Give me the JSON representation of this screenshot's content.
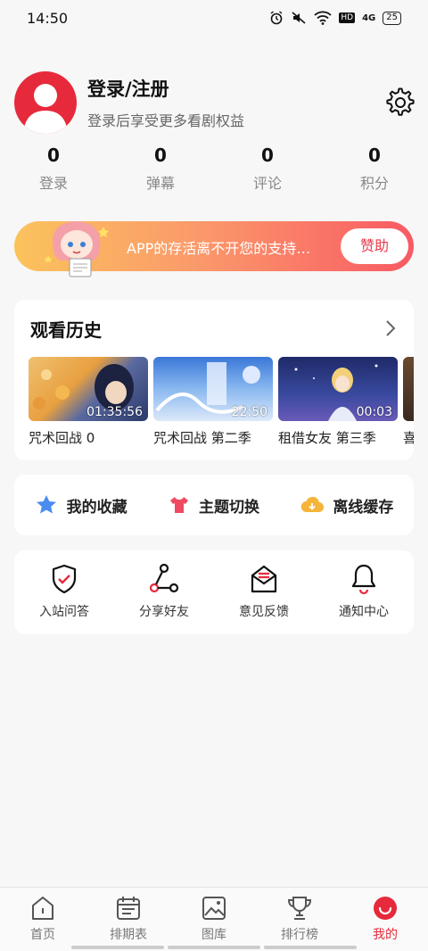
{
  "status_bar": {
    "time": "14:50",
    "battery": "25",
    "network": "4G",
    "hd": "HD"
  },
  "profile": {
    "title": "登录/注册",
    "subtitle": "登录后享受更多看剧权益"
  },
  "stats": [
    {
      "value": "0",
      "label": "登录"
    },
    {
      "value": "0",
      "label": "弹幕"
    },
    {
      "value": "0",
      "label": "评论"
    },
    {
      "value": "0",
      "label": "积分"
    }
  ],
  "banner": {
    "text": "APP的存活离不开您的支持…",
    "button": "赞助"
  },
  "history": {
    "title": "观看历史",
    "items": [
      {
        "title": "咒术回战 0",
        "time": "01:35:56"
      },
      {
        "title": "咒术回战 第二季",
        "time": "22:50"
      },
      {
        "title": "租借女友 第三季",
        "time": "00:03"
      },
      {
        "title": "喜",
        "time": ""
      }
    ]
  },
  "quick": [
    {
      "label": "我的收藏",
      "icon": "star-icon"
    },
    {
      "label": "主题切换",
      "icon": "shirt-icon"
    },
    {
      "label": "离线缓存",
      "icon": "cloud-download-icon"
    }
  ],
  "tools": [
    {
      "label": "入站问答",
      "icon": "shield-check-icon"
    },
    {
      "label": "分享好友",
      "icon": "share-icon"
    },
    {
      "label": "意见反馈",
      "icon": "mail-icon"
    },
    {
      "label": "通知中心",
      "icon": "bell-icon"
    }
  ],
  "tabs": [
    {
      "label": "首页",
      "icon": "home-icon"
    },
    {
      "label": "排期表",
      "icon": "calendar-icon"
    },
    {
      "label": "图库",
      "icon": "image-icon"
    },
    {
      "label": "排行榜",
      "icon": "trophy-icon"
    },
    {
      "label": "我的",
      "icon": "profile-icon"
    }
  ],
  "colors": {
    "accent": "#e62a3b",
    "banner_start": "#fbc35c",
    "banner_end": "#f85a63"
  }
}
